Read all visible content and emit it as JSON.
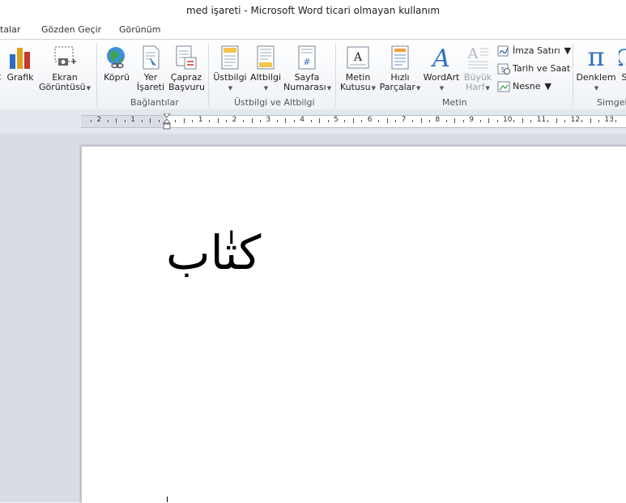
{
  "window": {
    "title": "med işareti  -  Microsoft Word ticari olmayan kullanım"
  },
  "tabs": [
    {
      "label": "talar"
    },
    {
      "label": "Gözden Geçir"
    },
    {
      "label": "Görünüm"
    }
  ],
  "ribbon": {
    "illustrations": {
      "partial_label": "t",
      "chart_label": "Grafik",
      "screenshot_label_1": "Ekran",
      "screenshot_label_2": "Görüntüsü"
    },
    "links": {
      "group_label": "Bağlantılar",
      "hyperlink_label": "Köprü",
      "bookmark_label_1": "Yer",
      "bookmark_label_2": "İşareti",
      "crossref_label_1": "Çapraz",
      "crossref_label_2": "Başvuru"
    },
    "header_footer": {
      "group_label": "Üstbilgi ve Altbilgi",
      "header_label": "Üstbilgi",
      "footer_label": "Altbilgi",
      "pagenum_label_1": "Sayfa",
      "pagenum_label_2": "Numarası"
    },
    "text": {
      "group_label": "Metin",
      "textbox_label_1": "Metin",
      "textbox_label_2": "Kutusu",
      "quickparts_label_1": "Hızlı",
      "quickparts_label_2": "Parçalar",
      "wordart_label": "WordArt",
      "dropcap_label_1": "Büyük",
      "dropcap_label_2": "Harf",
      "signature_label": "İmza Satırı",
      "datetime_label": "Tarih ve Saat",
      "object_label": "Nesne"
    },
    "symbols": {
      "group_label": "Simgeler",
      "equation_label": "Denklem",
      "partial_label": "S"
    }
  },
  "ruler": {
    "labels": [
      "2",
      "1",
      "1",
      "2",
      "3",
      "4",
      "5",
      "6",
      "7",
      "8",
      "9",
      "10",
      "11",
      "12",
      "13"
    ]
  },
  "document": {
    "text": "كتٰاب"
  },
  "icons": {
    "chart": "bar-chart-icon",
    "screenshot": "screenshot-icon",
    "hyperlink": "globe-link-icon",
    "bookmark": "bookmark-icon",
    "crossref": "cross-reference-icon",
    "header": "header-icon",
    "footer": "footer-icon",
    "pagenum": "page-number-icon",
    "textbox": "text-box-icon",
    "quickparts": "quick-parts-icon",
    "wordart": "wordart-icon",
    "dropcap": "drop-cap-icon",
    "signature": "signature-line-icon",
    "datetime": "date-time-icon",
    "object": "object-icon",
    "equation": "pi-icon"
  }
}
